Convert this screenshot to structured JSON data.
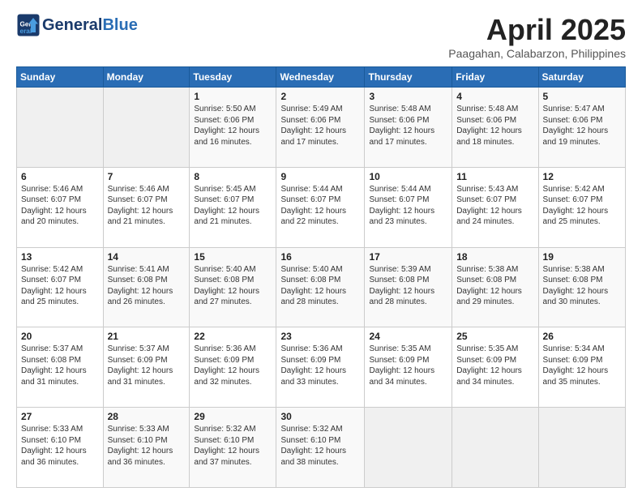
{
  "header": {
    "logo_general": "General",
    "logo_blue": "Blue",
    "month_year": "April 2025",
    "location": "Paagahan, Calabarzon, Philippines"
  },
  "weekdays": [
    "Sunday",
    "Monday",
    "Tuesday",
    "Wednesday",
    "Thursday",
    "Friday",
    "Saturday"
  ],
  "weeks": [
    [
      {
        "day": "",
        "info": ""
      },
      {
        "day": "",
        "info": ""
      },
      {
        "day": "1",
        "info": "Sunrise: 5:50 AM\nSunset: 6:06 PM\nDaylight: 12 hours and 16 minutes."
      },
      {
        "day": "2",
        "info": "Sunrise: 5:49 AM\nSunset: 6:06 PM\nDaylight: 12 hours and 17 minutes."
      },
      {
        "day": "3",
        "info": "Sunrise: 5:48 AM\nSunset: 6:06 PM\nDaylight: 12 hours and 17 minutes."
      },
      {
        "day": "4",
        "info": "Sunrise: 5:48 AM\nSunset: 6:06 PM\nDaylight: 12 hours and 18 minutes."
      },
      {
        "day": "5",
        "info": "Sunrise: 5:47 AM\nSunset: 6:06 PM\nDaylight: 12 hours and 19 minutes."
      }
    ],
    [
      {
        "day": "6",
        "info": "Sunrise: 5:46 AM\nSunset: 6:07 PM\nDaylight: 12 hours and 20 minutes."
      },
      {
        "day": "7",
        "info": "Sunrise: 5:46 AM\nSunset: 6:07 PM\nDaylight: 12 hours and 21 minutes."
      },
      {
        "day": "8",
        "info": "Sunrise: 5:45 AM\nSunset: 6:07 PM\nDaylight: 12 hours and 21 minutes."
      },
      {
        "day": "9",
        "info": "Sunrise: 5:44 AM\nSunset: 6:07 PM\nDaylight: 12 hours and 22 minutes."
      },
      {
        "day": "10",
        "info": "Sunrise: 5:44 AM\nSunset: 6:07 PM\nDaylight: 12 hours and 23 minutes."
      },
      {
        "day": "11",
        "info": "Sunrise: 5:43 AM\nSunset: 6:07 PM\nDaylight: 12 hours and 24 minutes."
      },
      {
        "day": "12",
        "info": "Sunrise: 5:42 AM\nSunset: 6:07 PM\nDaylight: 12 hours and 25 minutes."
      }
    ],
    [
      {
        "day": "13",
        "info": "Sunrise: 5:42 AM\nSunset: 6:07 PM\nDaylight: 12 hours and 25 minutes."
      },
      {
        "day": "14",
        "info": "Sunrise: 5:41 AM\nSunset: 6:08 PM\nDaylight: 12 hours and 26 minutes."
      },
      {
        "day": "15",
        "info": "Sunrise: 5:40 AM\nSunset: 6:08 PM\nDaylight: 12 hours and 27 minutes."
      },
      {
        "day": "16",
        "info": "Sunrise: 5:40 AM\nSunset: 6:08 PM\nDaylight: 12 hours and 28 minutes."
      },
      {
        "day": "17",
        "info": "Sunrise: 5:39 AM\nSunset: 6:08 PM\nDaylight: 12 hours and 28 minutes."
      },
      {
        "day": "18",
        "info": "Sunrise: 5:38 AM\nSunset: 6:08 PM\nDaylight: 12 hours and 29 minutes."
      },
      {
        "day": "19",
        "info": "Sunrise: 5:38 AM\nSunset: 6:08 PM\nDaylight: 12 hours and 30 minutes."
      }
    ],
    [
      {
        "day": "20",
        "info": "Sunrise: 5:37 AM\nSunset: 6:08 PM\nDaylight: 12 hours and 31 minutes."
      },
      {
        "day": "21",
        "info": "Sunrise: 5:37 AM\nSunset: 6:09 PM\nDaylight: 12 hours and 31 minutes."
      },
      {
        "day": "22",
        "info": "Sunrise: 5:36 AM\nSunset: 6:09 PM\nDaylight: 12 hours and 32 minutes."
      },
      {
        "day": "23",
        "info": "Sunrise: 5:36 AM\nSunset: 6:09 PM\nDaylight: 12 hours and 33 minutes."
      },
      {
        "day": "24",
        "info": "Sunrise: 5:35 AM\nSunset: 6:09 PM\nDaylight: 12 hours and 34 minutes."
      },
      {
        "day": "25",
        "info": "Sunrise: 5:35 AM\nSunset: 6:09 PM\nDaylight: 12 hours and 34 minutes."
      },
      {
        "day": "26",
        "info": "Sunrise: 5:34 AM\nSunset: 6:09 PM\nDaylight: 12 hours and 35 minutes."
      }
    ],
    [
      {
        "day": "27",
        "info": "Sunrise: 5:33 AM\nSunset: 6:10 PM\nDaylight: 12 hours and 36 minutes."
      },
      {
        "day": "28",
        "info": "Sunrise: 5:33 AM\nSunset: 6:10 PM\nDaylight: 12 hours and 36 minutes."
      },
      {
        "day": "29",
        "info": "Sunrise: 5:32 AM\nSunset: 6:10 PM\nDaylight: 12 hours and 37 minutes."
      },
      {
        "day": "30",
        "info": "Sunrise: 5:32 AM\nSunset: 6:10 PM\nDaylight: 12 hours and 38 minutes."
      },
      {
        "day": "",
        "info": ""
      },
      {
        "day": "",
        "info": ""
      },
      {
        "day": "",
        "info": ""
      }
    ]
  ]
}
